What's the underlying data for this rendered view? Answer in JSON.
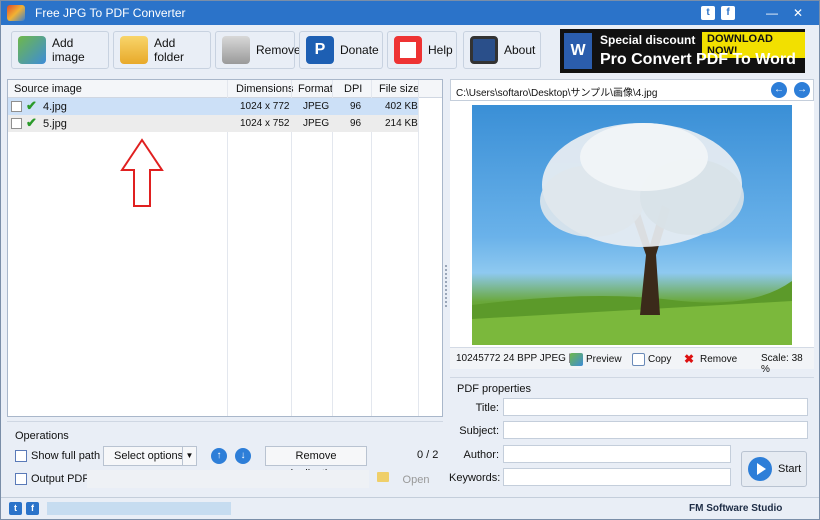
{
  "window": {
    "title": "Free JPG To PDF Converter"
  },
  "titlebar": {
    "twitter_icon": "t",
    "facebook_icon": "f",
    "minimize": "—",
    "close": "✕"
  },
  "toolbar": {
    "add_image": "Add image",
    "add_folder": "Add folder",
    "remove": "Remove",
    "donate": "Donate",
    "help": "Help",
    "about": "About",
    "donate_icon_letter": "P"
  },
  "banner": {
    "word_icon_letter": "W",
    "special": "Special discount",
    "download": "DOWNLOAD NOW!",
    "product": "Pro Convert PDF To Word"
  },
  "file_list": {
    "headers": [
      "Source image",
      "Dimensions",
      "Format",
      "DPI",
      "File size"
    ],
    "rows": [
      {
        "name": "4.jpg",
        "dimensions": "1024 x 772",
        "format": "JPEG",
        "dpi": "96",
        "size": "402 KB"
      },
      {
        "name": "5.jpg",
        "dimensions": "1024 x 752",
        "format": "JPEG",
        "dpi": "96",
        "size": "214 KB"
      }
    ]
  },
  "operations": {
    "title": "Operations",
    "show_full_path": "Show full path",
    "select_options": "Select options",
    "remove_duplications": "Remove duplications",
    "count": "0 / 2",
    "output_pdf": "Output PDF:",
    "open": "Open"
  },
  "preview": {
    "path": "C:\\Users\\softaro\\Desktop\\サンプル\\画像\\4.jpg",
    "info": "10245772  24 BPP  JPEG  |",
    "preview_btn": "Preview",
    "copy_btn": "Copy",
    "remove_btn": "Remove",
    "scale": "Scale: 38 %"
  },
  "pdf_properties": {
    "title": "PDF properties",
    "labels": {
      "title": "Title:",
      "subject": "Subject:",
      "author": "Author:",
      "keywords": "Keywords:"
    },
    "start": "Start"
  },
  "statusbar": {
    "brand": "FM Software Studio"
  },
  "colors": {
    "titlebar": "#2b73c9",
    "selection": "#cce0f7",
    "accent": "#2d7ed8",
    "arrow": "#e02020"
  }
}
